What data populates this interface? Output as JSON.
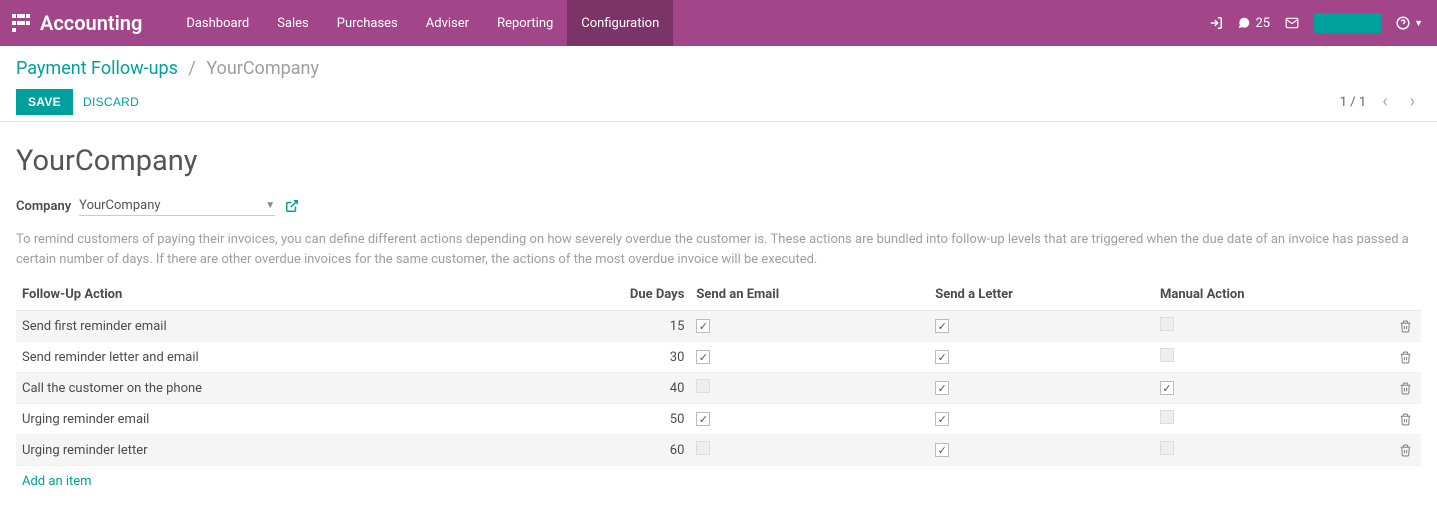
{
  "header": {
    "app_title": "Accounting",
    "menu": [
      "Dashboard",
      "Sales",
      "Purchases",
      "Adviser",
      "Reporting",
      "Configuration"
    ],
    "active_menu_index": 5,
    "msg_count": "25"
  },
  "breadcrumb": {
    "parent": "Payment Follow-ups",
    "current": "YourCompany"
  },
  "buttons": {
    "save": "SAVE",
    "discard": "DISCARD"
  },
  "pager": {
    "position": "1 / 1"
  },
  "record": {
    "title": "YourCompany",
    "company_label": "Company",
    "company_value": "YourCompany",
    "help_text": "To remind customers of paying their invoices, you can define different actions depending on how severely overdue the customer is. These actions are bundled into follow-up levels that are triggered when the due date of an invoice has passed a certain number of days. If there are other overdue invoices for the same customer, the actions of the most overdue invoice will be executed."
  },
  "table": {
    "columns": {
      "action": "Follow-Up Action",
      "due_days": "Due Days",
      "send_email": "Send an Email",
      "send_letter": "Send a Letter",
      "manual_action": "Manual Action"
    },
    "rows": [
      {
        "action": "Send first reminder email",
        "due_days": "15",
        "email": true,
        "letter": true,
        "manual": false
      },
      {
        "action": "Send reminder letter and email",
        "due_days": "30",
        "email": true,
        "letter": true,
        "manual": false
      },
      {
        "action": "Call the customer on the phone",
        "due_days": "40",
        "email": false,
        "letter": true,
        "manual": true
      },
      {
        "action": "Urging reminder email",
        "due_days": "50",
        "email": true,
        "letter": true,
        "manual": false
      },
      {
        "action": "Urging reminder letter",
        "due_days": "60",
        "email": false,
        "letter": true,
        "manual": false
      }
    ],
    "add_item": "Add an item"
  }
}
